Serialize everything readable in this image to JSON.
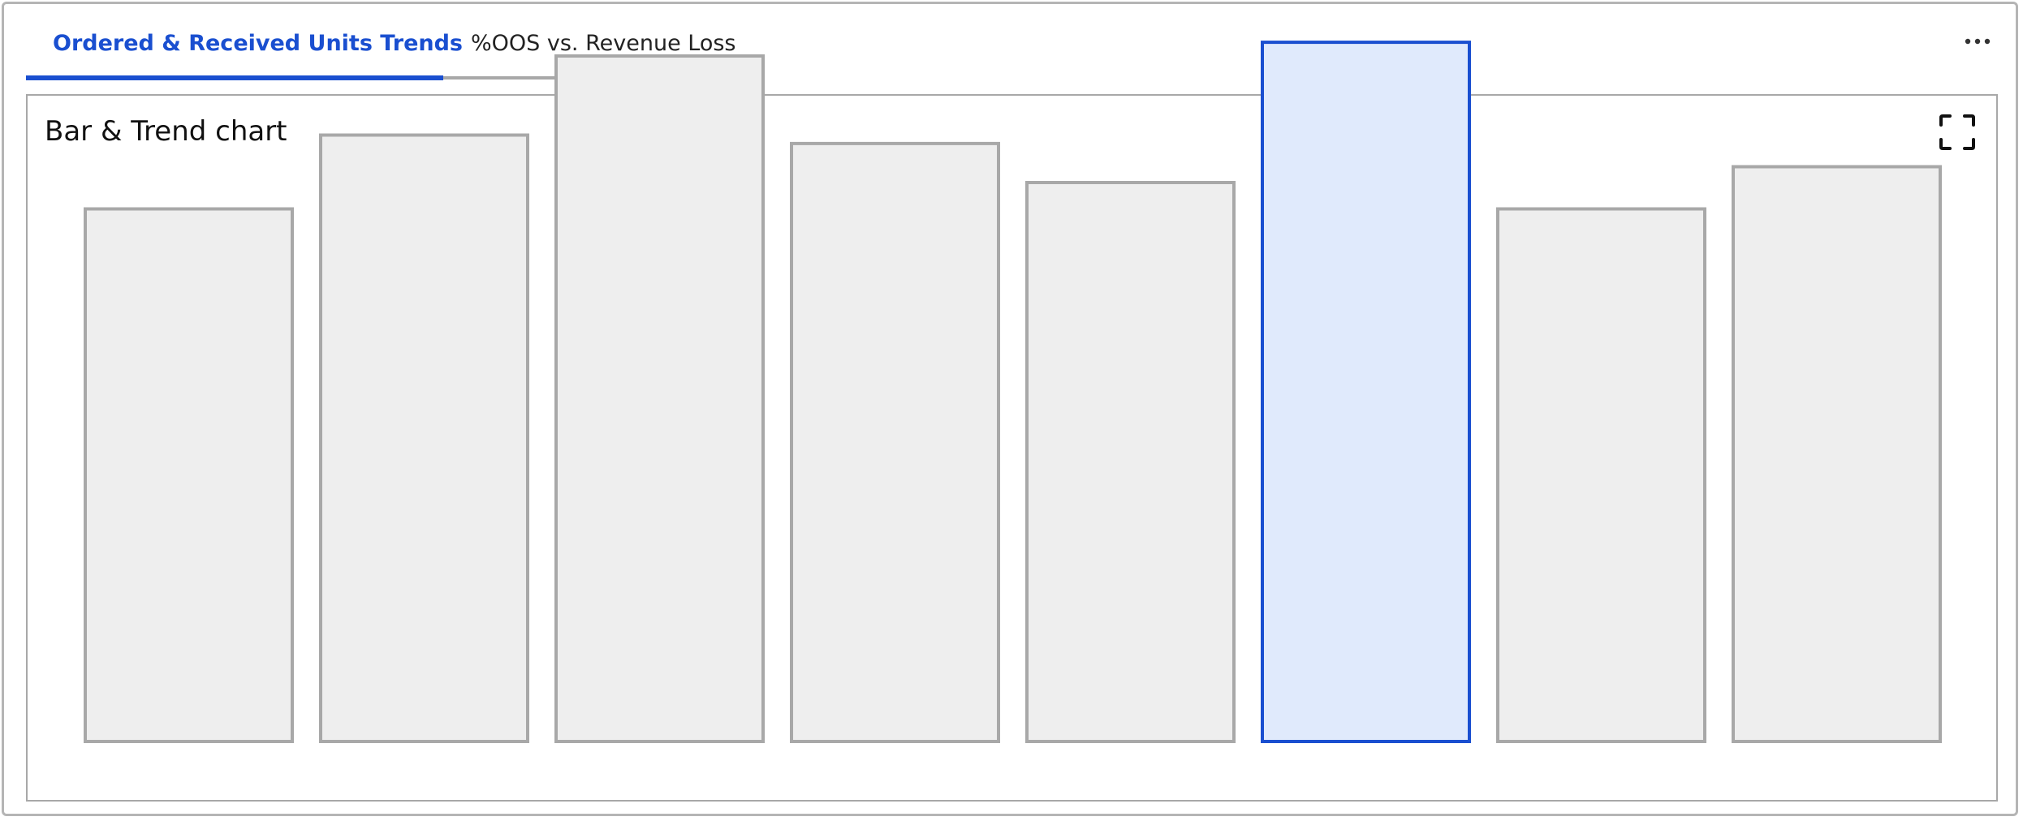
{
  "tabs": [
    {
      "label": "Ordered & Received Units Trends",
      "active": true
    },
    {
      "label": "%OOS vs. Revenue Loss",
      "active": false
    }
  ],
  "panel": {
    "title": "Bar & Trend chart",
    "expand_icon": "expand-icon",
    "more_icon": "more-horizontal-icon"
  },
  "colors": {
    "accent": "#1a4fd0",
    "bar_fill": "#eeeeee",
    "bar_stroke": "#a8a8a8",
    "selected_fill": "#e0eafc",
    "selected_stroke": "#1a4fd0"
  },
  "chart_data": {
    "type": "bar",
    "categories": [
      "",
      "",
      "",
      "",
      "",
      "",
      "",
      ""
    ],
    "values": [
      50.5,
      57.5,
      65,
      56.7,
      53,
      66.3,
      50.5,
      54.5
    ],
    "selected_index": 5,
    "ylim": [
      0,
      70
    ],
    "grid": false,
    "title": "",
    "xlabel": "",
    "ylabel": ""
  }
}
